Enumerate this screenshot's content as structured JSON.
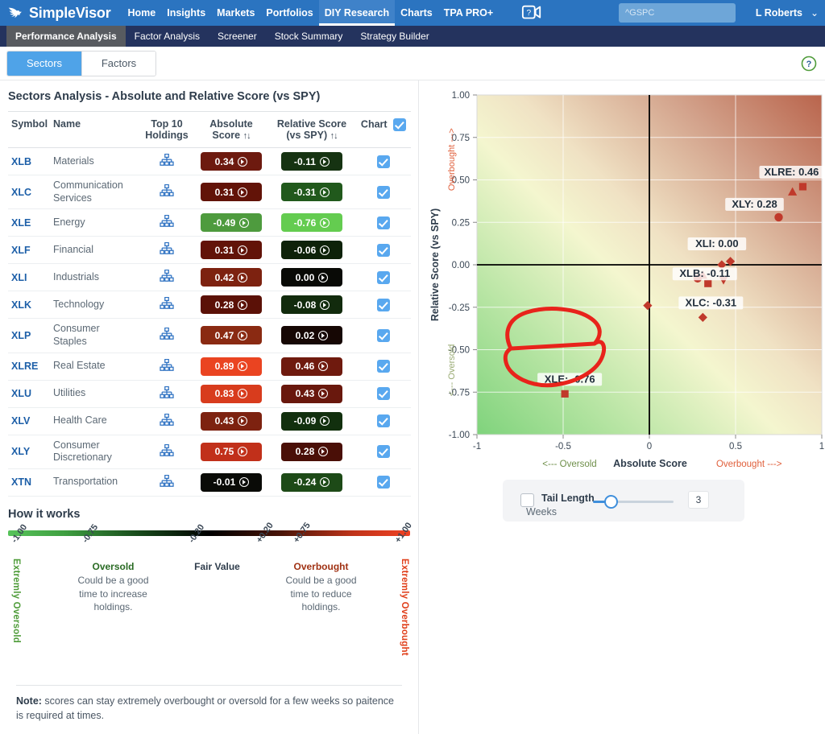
{
  "header": {
    "brand": "SimpleVisor",
    "nav": [
      {
        "label": "Home",
        "active": false
      },
      {
        "label": "Insights",
        "active": false
      },
      {
        "label": "Markets",
        "active": false
      },
      {
        "label": "Portfolios",
        "active": false
      },
      {
        "label": "DIY Research",
        "active": true
      },
      {
        "label": "Charts",
        "active": false
      },
      {
        "label": "TPA PRO+",
        "active": false
      }
    ],
    "search_placeholder": "^GSPC",
    "search_value": "",
    "user": "L Roberts",
    "caret": "⌄"
  },
  "subnav": [
    {
      "label": "Performance Analysis",
      "active": true
    },
    {
      "label": "Factor Analysis",
      "active": false
    },
    {
      "label": "Screener",
      "active": false
    },
    {
      "label": "Stock Summary",
      "active": false
    },
    {
      "label": "Strategy Builder",
      "active": false
    }
  ],
  "tabs": [
    {
      "label": "Sectors",
      "selected": true
    },
    {
      "label": "Factors",
      "selected": false
    }
  ],
  "panel": {
    "title": "Sectors Analysis - Absolute and Relative Score (vs SPY)",
    "columns": {
      "symbol": "Symbol",
      "name": "Name",
      "holdings_l1": "Top 10",
      "holdings_l2": "Holdings",
      "absolute_l1": "Absolute",
      "absolute_l2": "Score",
      "relative_l1": "Relative Score",
      "relative_l2": "(vs SPY)",
      "chart": "Chart",
      "sort_glyph": "↑↓"
    },
    "rows": [
      {
        "symbol": "XLB",
        "name": "Materials",
        "absolute": "0.34",
        "relative": "-0.11",
        "abs_color": "#6d1a0f",
        "rel_color": "#163312",
        "checked": true
      },
      {
        "symbol": "XLC",
        "name": "Communication Services",
        "absolute": "0.31",
        "relative": "-0.31",
        "abs_color": "#621308",
        "rel_color": "#21591c",
        "checked": true
      },
      {
        "symbol": "XLE",
        "name": "Energy",
        "absolute": "-0.49",
        "relative": "-0.76",
        "abs_color": "#4e9b3e",
        "rel_color": "#64cc50",
        "checked": true
      },
      {
        "symbol": "XLF",
        "name": "Financial",
        "absolute": "0.31",
        "relative": "-0.06",
        "abs_color": "#621308",
        "rel_color": "#0e2209",
        "checked": true
      },
      {
        "symbol": "XLI",
        "name": "Industrials",
        "absolute": "0.42",
        "relative": "0.00",
        "abs_color": "#7d2210",
        "rel_color": "#090a06",
        "checked": true
      },
      {
        "symbol": "XLK",
        "name": "Technology",
        "absolute": "0.28",
        "relative": "-0.08",
        "abs_color": "#5b1107",
        "rel_color": "#122b0d",
        "checked": true
      },
      {
        "symbol": "XLP",
        "name": "Consumer Staples",
        "absolute": "0.47",
        "relative": "0.02",
        "abs_color": "#8a2a12",
        "rel_color": "#160704",
        "checked": true
      },
      {
        "symbol": "XLRE",
        "name": "Real Estate",
        "absolute": "0.89",
        "relative": "0.46",
        "abs_color": "#ea4421",
        "rel_color": "#6f1a0e",
        "checked": true
      },
      {
        "symbol": "XLU",
        "name": "Utilities",
        "absolute": "0.83",
        "relative": "0.43",
        "abs_color": "#d83c1d",
        "rel_color": "#69180d",
        "checked": true
      },
      {
        "symbol": "XLV",
        "name": "Health Care",
        "absolute": "0.43",
        "relative": "-0.09",
        "abs_color": "#7d2210",
        "rel_color": "#12300e",
        "checked": true
      },
      {
        "symbol": "XLY",
        "name": "Consumer Discretionary",
        "absolute": "0.75",
        "relative": "0.28",
        "abs_color": "#c1301a",
        "rel_color": "#4a0f07",
        "checked": true
      },
      {
        "symbol": "XTN",
        "name": "Transportation",
        "absolute": "-0.01",
        "relative": "-0.24",
        "abs_color": "#0a0b07",
        "rel_color": "#1d4a17",
        "checked": true
      }
    ]
  },
  "how_it_works": {
    "title": "How it works",
    "ticks": [
      "-1.00",
      "-0.75",
      "-0.20",
      "+0.20",
      "+0.75",
      "+1.00"
    ],
    "left_vertical": "Extremly Oversold",
    "right_vertical": "Extremly Overbought",
    "blocks": [
      {
        "head": "Oversold",
        "head_color": "#2a6b24",
        "body": "Could be a good time to increase holdings."
      },
      {
        "head": "Fair Value",
        "head_color": "#2f3d4c",
        "body": ""
      },
      {
        "head": "Overbought",
        "head_color": "#a03214",
        "body": "Could be a good time to reduce holdings."
      }
    ],
    "note_bold": "Note:",
    "note_text": " scores can stay extremely overbought or oversold for a few weeks so paitence is required at times."
  },
  "slider": {
    "label": "Tail Length",
    "label2": "Weeks",
    "value": "3",
    "checked": false
  },
  "chart_data": {
    "type": "scatter",
    "title": "",
    "xlabel": "Absolute Score",
    "ylabel": "Relative Score (vs SPY)",
    "xlim": [
      -1,
      1
    ],
    "ylim": [
      -1,
      1
    ],
    "xticks": [
      "-1",
      "-0.5",
      "0",
      "0.5",
      "1"
    ],
    "yticks": [
      "1.00",
      "0.75",
      "0.50",
      "0.25",
      "0.00",
      "-0.25",
      "-0.50",
      "-0.75",
      "-1.00"
    ],
    "x_axis_left_note": "<--- Oversold",
    "x_axis_right_note": "Overbought --->",
    "y_axis_top_note": "Overbought --->",
    "y_axis_bottom_note": "<--- Oversold",
    "grid": true,
    "points": [
      {
        "label": "XLRE: 0.46",
        "x": 0.89,
        "y": 0.46,
        "marker": "square",
        "show_label": true
      },
      {
        "label": "XLY: 0.28",
        "x": 0.75,
        "y": 0.28,
        "marker": "circle",
        "show_label": true
      },
      {
        "label": "XLU",
        "x": 0.83,
        "y": 0.43,
        "marker": "triangle-up",
        "show_label": false
      },
      {
        "label": "XLI: 0.00",
        "x": 0.42,
        "y": 0.0,
        "marker": "diamond",
        "show_label": true
      },
      {
        "label": "XLB: -0.11",
        "x": 0.34,
        "y": -0.11,
        "marker": "square",
        "show_label": true
      },
      {
        "label": "XLK",
        "x": 0.28,
        "y": -0.08,
        "marker": "circle",
        "show_label": false
      },
      {
        "label": "XLF",
        "x": 0.31,
        "y": -0.06,
        "marker": "triangle-up",
        "show_label": false
      },
      {
        "label": "XLV",
        "x": 0.43,
        "y": -0.09,
        "marker": "triangle-down",
        "show_label": false
      },
      {
        "label": "XLP",
        "x": 0.47,
        "y": 0.02,
        "marker": "diamond",
        "show_label": false
      },
      {
        "label": "XLC: -0.31",
        "x": 0.31,
        "y": -0.31,
        "marker": "diamond",
        "show_label": true
      },
      {
        "label": "XTN",
        "x": -0.01,
        "y": -0.24,
        "marker": "diamond",
        "show_label": false
      },
      {
        "label": "XLE: -0.76",
        "x": -0.49,
        "y": -0.76,
        "marker": "square",
        "show_label": true
      }
    ],
    "annotation": {
      "type": "hand-drawn-circle",
      "color": "#e8231b",
      "around": "XLE: -0.76"
    }
  },
  "colors": {
    "topbar": "#2b74c0",
    "subbar": "#24335e",
    "accent": "#4fa3e8",
    "marker": "#c0392b",
    "annotation": "#e8231b"
  }
}
